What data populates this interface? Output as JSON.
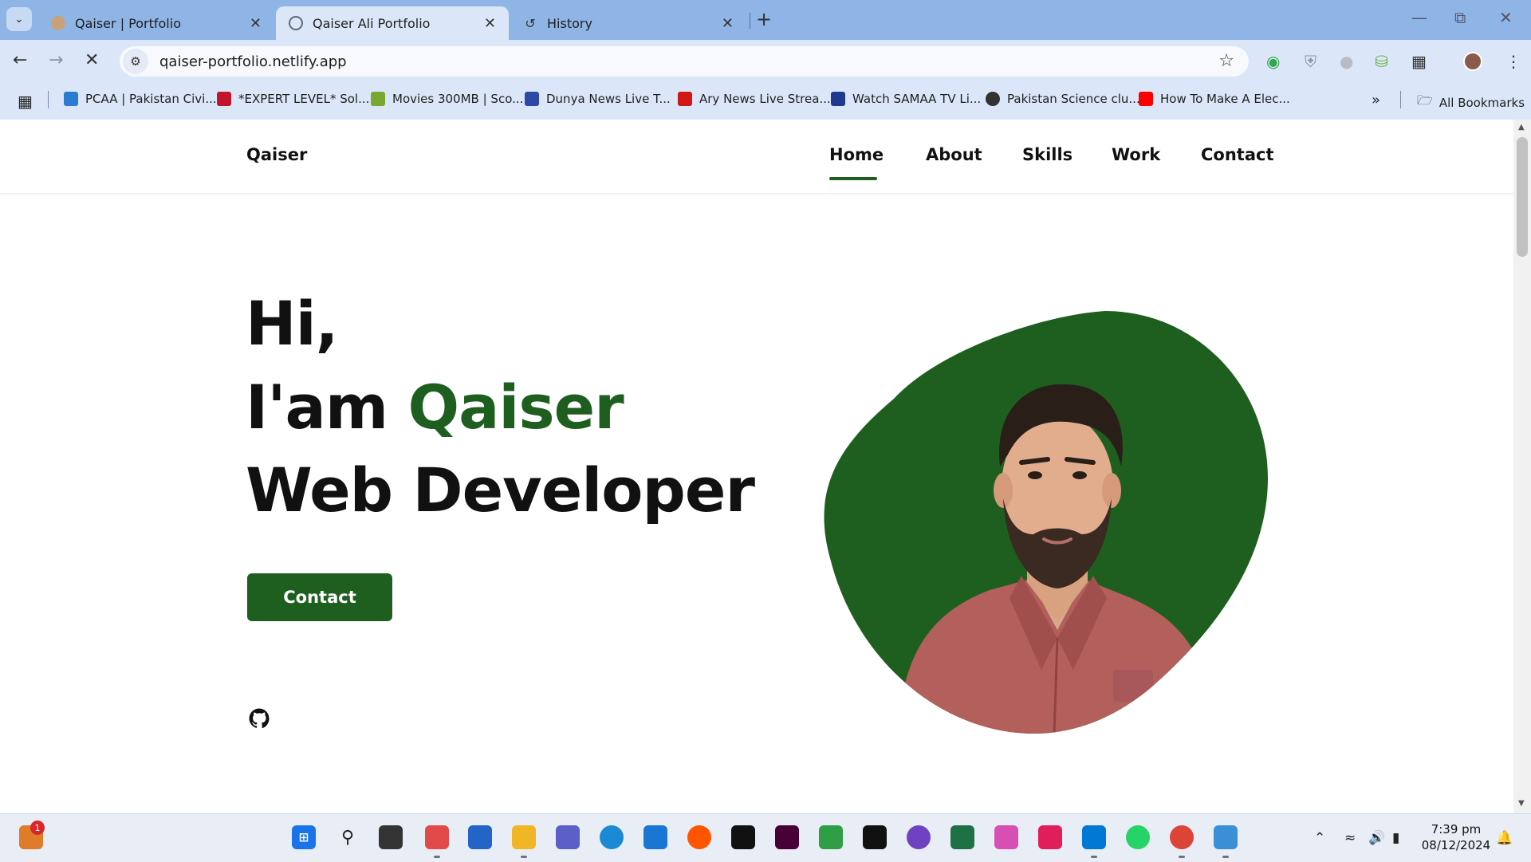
{
  "browser": {
    "tabs": [
      {
        "title": "Qaiser | Portfolio",
        "active": false
      },
      {
        "title": "Qaiser Ali Portfolio",
        "active": true
      },
      {
        "title": "History",
        "active": false
      }
    ],
    "url": "qaiser-portfolio.netlify.app",
    "bookmarks": [
      {
        "label": "PCAA | Pakistan Civi...",
        "icon_color": "#2b7bd1"
      },
      {
        "label": "*EXPERT LEVEL* Sol...",
        "icon_color": "#c0152a"
      },
      {
        "label": "Movies 300MB | Sco...",
        "icon_color": "#78a832"
      },
      {
        "label": "Dunya News Live T...",
        "icon_color": "#2a4aa6"
      },
      {
        "label": "Ary News Live Strea...",
        "icon_color": "#d11616"
      },
      {
        "label": "Watch SAMAA TV Li...",
        "icon_color": "#1d3a8f"
      },
      {
        "label": "Pakistan Science clu...",
        "icon_color": "#333333"
      },
      {
        "label": "How To Make A Elec...",
        "icon_color": "#ff0000"
      }
    ],
    "all_bookmarks_label": "All Bookmarks"
  },
  "site": {
    "brand": "Qaiser",
    "nav": [
      "Home",
      "About",
      "Skills",
      "Work",
      "Contact"
    ],
    "active_nav": "Home",
    "hero": {
      "line1": "Hi,",
      "line2_prefix": "I'am ",
      "line2_name": "Qaiser",
      "line3": "Web Developer"
    },
    "contact_button": "Contact",
    "accent_color": "#1e5f20"
  },
  "taskbar": {
    "notification_count": "1",
    "time": "7:39 pm",
    "date": "08/12/2024"
  }
}
